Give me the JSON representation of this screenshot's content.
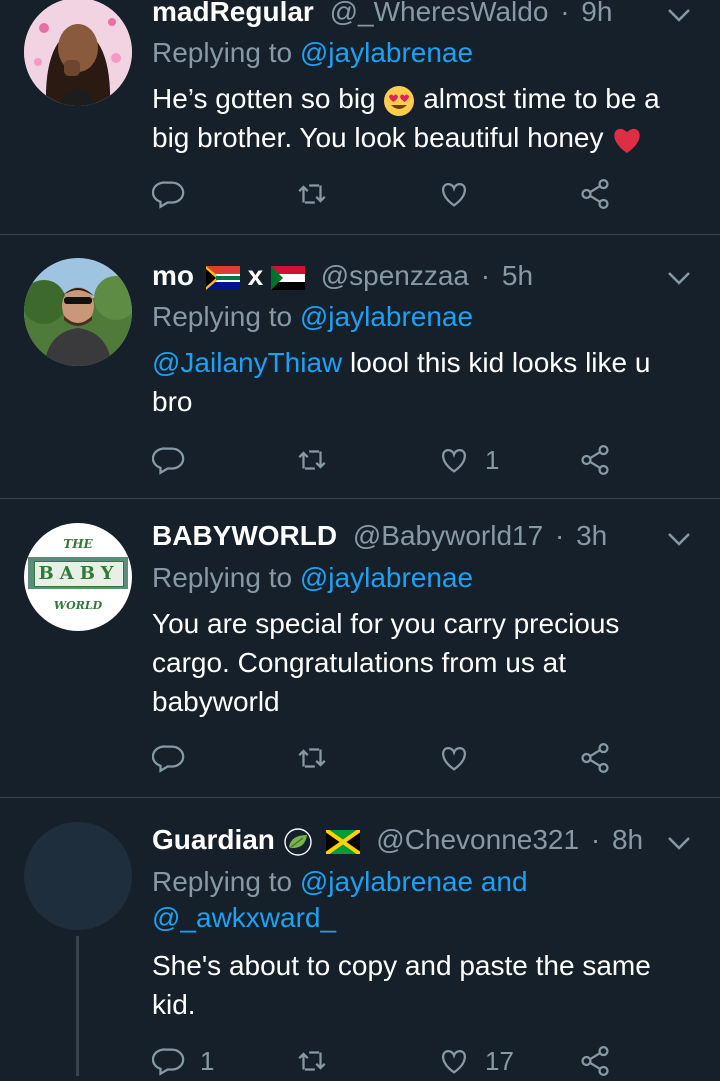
{
  "colors": {
    "background": "#15202b",
    "divider": "#38444d",
    "muted": "#8899a6",
    "link": "#1da1f2",
    "text": "#ffffff"
  },
  "tweets": [
    {
      "name": "madRegular",
      "handle": "@_WheresWaldo",
      "separator": "·",
      "time": "9h",
      "replying_prefix": "Replying to",
      "replying_to": "@jaylabrenae",
      "body_part1": "He’s gotten so big",
      "body_part2": " almost time to be a big brother. You look beautiful honey",
      "emoji_1": "heart-eyes-emoji",
      "emoji_2": "red-heart-emoji",
      "reply_count": "",
      "like_count": ""
    },
    {
      "name": "mo",
      "name_sep": "x",
      "flag_1": "south-africa-flag",
      "flag_2": "sudan-flag",
      "handle": "@spenzzaa",
      "separator": "·",
      "time": "5h",
      "replying_prefix": "Replying to",
      "replying_to": "@jaylabrenae",
      "mention": "@JailanyThiaw",
      "body": " loool this kid looks like u bro",
      "reply_count": "",
      "like_count": "1"
    },
    {
      "name": "BABYWORLD",
      "handle": "@Babyworld17",
      "separator": "·",
      "time": "3h",
      "avatar_text_top": "THE",
      "avatar_text_mid": "BABY",
      "avatar_text_bottom": "WORLD",
      "replying_prefix": "Replying to",
      "replying_to": "@jaylabrenae",
      "body": "You are special for you carry precious cargo. Congratulations from us at babyworld",
      "reply_count": "",
      "like_count": ""
    },
    {
      "name": "Guardian",
      "leaf_icon": "leaf-emoji",
      "flag": "jamaica-flag",
      "handle": "@Chevonne321",
      "separator": "·",
      "time": "8h",
      "replying_prefix": "Replying to",
      "replying_to": "@jaylabrenae",
      "replying_and": "and",
      "replying_to_2": "@_awkxward_",
      "body": "She's about to copy and paste the same kid.",
      "reply_count": "1",
      "like_count": "17"
    }
  ]
}
